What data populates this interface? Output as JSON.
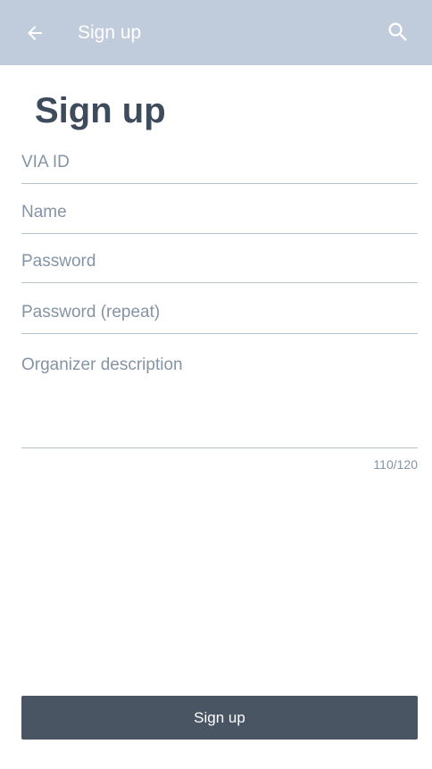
{
  "appbar": {
    "title": "Sign up",
    "back_icon": "arrow-left-icon",
    "search_icon": "search-icon",
    "background": "#c0ccdb"
  },
  "page": {
    "title": "Sign up"
  },
  "form": {
    "via_id": {
      "placeholder": "VIA ID",
      "value": ""
    },
    "name": {
      "placeholder": "Name",
      "value": ""
    },
    "password": {
      "placeholder": "Password",
      "value": ""
    },
    "password_repeat": {
      "placeholder": "Password (repeat)",
      "value": ""
    },
    "organizer_description": {
      "placeholder": "Organizer description",
      "value": ""
    },
    "description_counter": "110/120"
  },
  "actions": {
    "submit_label": "Sign up",
    "submit_color": "#4a5564"
  }
}
